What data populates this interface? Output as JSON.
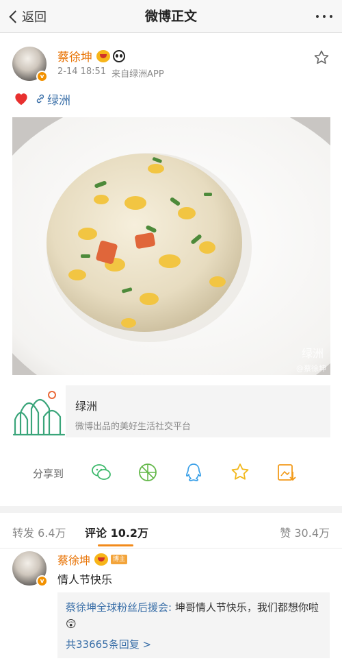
{
  "nav": {
    "back_label": "返回",
    "title": "微博正文"
  },
  "post": {
    "author": "蔡徐坤",
    "verified_mark": "v",
    "time": "2-14 18:51",
    "source": "来自绿洲APP",
    "link_text": "绿洲",
    "image_watermark": "绿洲",
    "image_credit": "@蔡徐坤"
  },
  "card": {
    "title": "绿洲",
    "subtitle": "微博出品的美好生活社交平台"
  },
  "share": {
    "label": "分享到",
    "icons": [
      "wechat-icon",
      "moments-icon",
      "qq-icon",
      "qzone-star-icon",
      "save-image-icon"
    ]
  },
  "tabs": {
    "repost": "转发 6.4万",
    "comment": "评论 10.2万",
    "like": "赞 30.4万"
  },
  "comment": {
    "author": "蔡徐坤",
    "badge": "博主",
    "text": "情人节快乐",
    "reply_author": "蔡徐坤全球粉丝后援会:",
    "reply_text": " 坤哥情人节快乐，我们都想你啦😲",
    "reply_more": "共33665条回复 >"
  },
  "colors": {
    "accent": "#e87304",
    "link": "#3a6fa8",
    "indicator": "#f28a1a"
  }
}
